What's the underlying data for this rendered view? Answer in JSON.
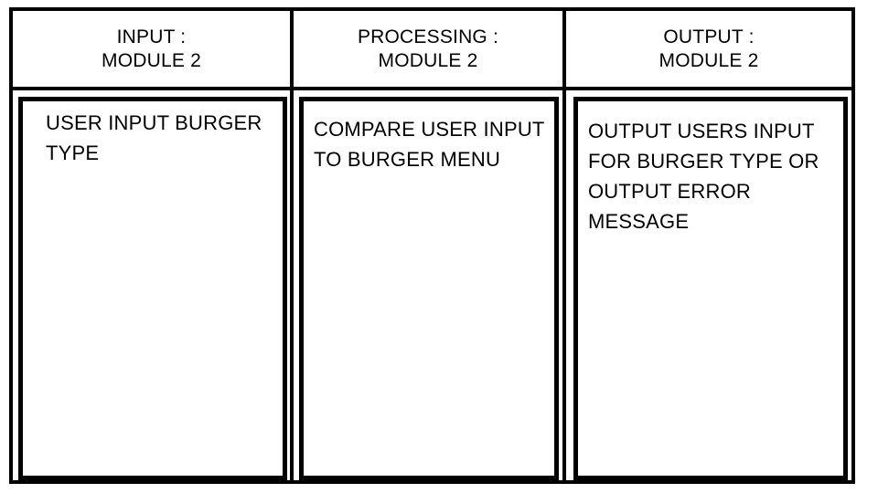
{
  "columns": [
    {
      "header_line1": "INPUT :",
      "header_line2": "MODULE 2",
      "body": "USER INPUT BURGER\nTYPE"
    },
    {
      "header_line1": "PROCESSING :",
      "header_line2": "MODULE 2",
      "body": "COMPARE USER INPUT\nTO BURGER MENU"
    },
    {
      "header_line1": "OUTPUT :",
      "header_line2": "MODULE 2",
      "body": "OUTPUT USERS INPUT\nFOR BURGER TYPE OR\nOUTPUT ERROR\nMESSAGE"
    }
  ]
}
